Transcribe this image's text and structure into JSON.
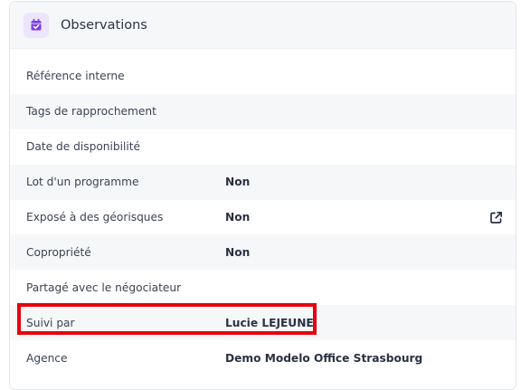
{
  "section": {
    "title": "Observations",
    "icon": "calendar-check-icon",
    "icon_color": "#7b3fe4",
    "icon_bg": "#ece5fb"
  },
  "rows": [
    {
      "label": "Référence interne",
      "value": ""
    },
    {
      "label": "Tags de rapprochement",
      "value": ""
    },
    {
      "label": "Date de disponibilité",
      "value": ""
    },
    {
      "label": "Lot d'un programme",
      "value": "Non"
    },
    {
      "label": "Exposé à des géorisques",
      "value": "Non",
      "action_icon": "external-link-icon"
    },
    {
      "label": "Copropriété",
      "value": "Non"
    },
    {
      "label": "Partagé avec le négociateur",
      "value": ""
    },
    {
      "label": "Suivi par",
      "value": "Lucie LEJEUNE"
    },
    {
      "label": "Agence",
      "value": "Demo Modelo Office Strasbourg"
    }
  ],
  "highlight": {
    "target_row": "Suivi par",
    "color": "#e8000b"
  }
}
